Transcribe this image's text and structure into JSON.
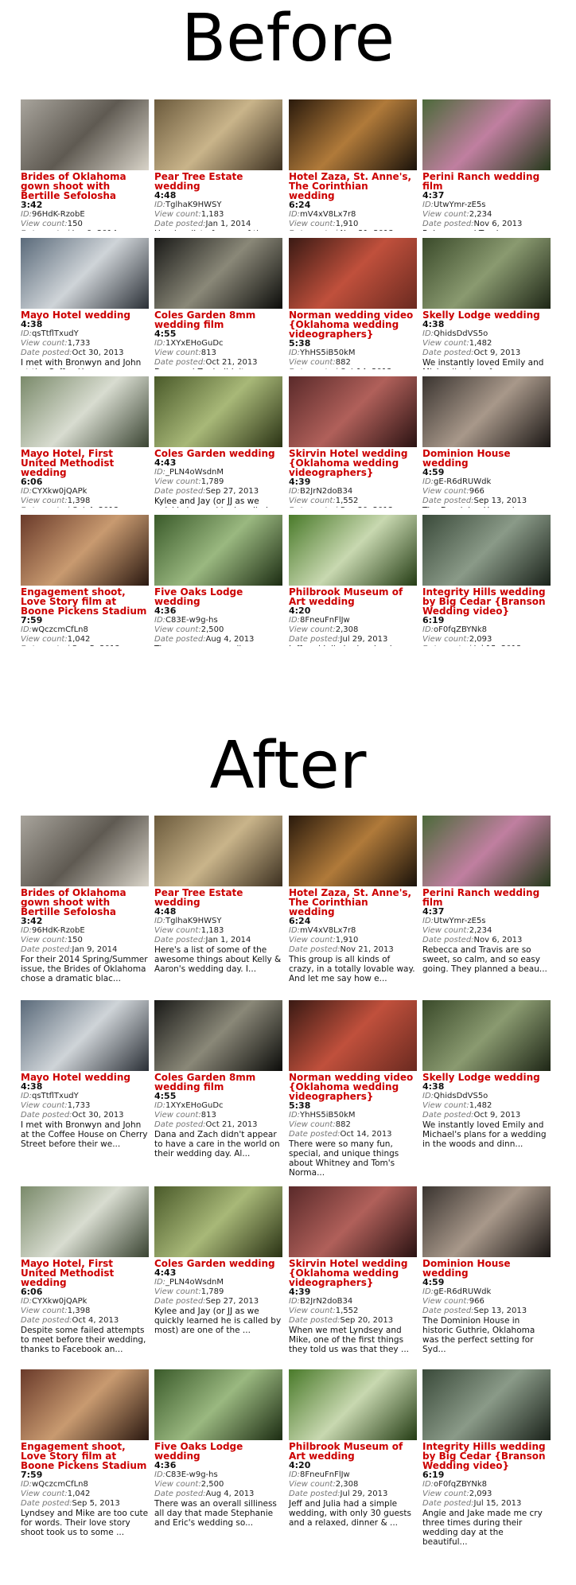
{
  "headings": {
    "before": "Before",
    "after": "After"
  },
  "labels": {
    "id": "ID:",
    "views": "View count:",
    "date": "Date posted:"
  },
  "videos": [
    {
      "title": "Brides of Oklahoma gown shoot with Bertille Sefolosha",
      "duration": "3:42",
      "id": "96HdK-RzobE",
      "views": "150",
      "date": "Jan 9, 2014",
      "desc_before": "",
      "desc_after": "For their 2014 Spring/Summer issue, the Brides of Oklahoma chose a dramatic blac...",
      "colors": [
        "#a8a49c",
        "#5f5a52",
        "#d8d3c8"
      ]
    },
    {
      "title": "Pear Tree Estate wedding",
      "duration": "4:48",
      "id": "TglhaK9HWSY",
      "views": "1,183",
      "date": "Jan 1, 2014",
      "desc_before": "Here's a list of some of the",
      "desc_after": "Here's a list of some of the awesome things about Kelly & Aaron's wedding day. I...",
      "colors": [
        "#6b5a3c",
        "#c9b48a",
        "#3c3020"
      ]
    },
    {
      "title": "Hotel Zaza, St. Anne's, The Corinthian wedding",
      "duration": "6:24",
      "id": "mV4xV8Lx7r8",
      "views": "1,910",
      "date": "Nov 21, 2013",
      "desc_before": "",
      "desc_after": "This group is all kinds of crazy, in a totally lovable way. And let me say how e...",
      "colors": [
        "#2a1a0c",
        "#b07a3a",
        "#1a120a"
      ]
    },
    {
      "title": "Perini Ranch wedding film",
      "duration": "4:37",
      "id": "UtwYmr-zE5s",
      "views": "2,234",
      "date": "Nov 6, 2013",
      "desc_before": "Rebecca and Travis are so",
      "desc_after": "Rebecca and Travis are so sweet, so calm, and so easy going. They planned a beau...",
      "colors": [
        "#4c6a3a",
        "#c07fa0",
        "#263a1c"
      ]
    },
    {
      "title": "Mayo Hotel wedding",
      "duration": "4:38",
      "id": "qsTtflTxudY",
      "views": "1,733",
      "date": "Oct 30, 2013",
      "desc_before": "I met with Bronwyn and John at the Coffee House on",
      "desc_after": "I met with Bronwyn and John at the Coffee House on Cherry Street before their we...",
      "colors": [
        "#5a6a7a",
        "#cfd4d8",
        "#2a2f36"
      ]
    },
    {
      "title": "Coles Garden 8mm wedding film",
      "duration": "4:55",
      "id": "1XYxEHoGuDc",
      "views": "813",
      "date": "Oct 21, 2013",
      "desc_before": "Dana and Zach didn't",
      "desc_after": "Dana and Zach didn't appear to have a care in the world on their wedding day. Al...",
      "colors": [
        "#1a1a18",
        "#8a8878",
        "#0c0c0a"
      ]
    },
    {
      "title": "Norman wedding video {Oklahoma wedding videographers}",
      "duration": "5:38",
      "id": "YhHS5iB50kM",
      "views": "882",
      "date": "Oct 14, 2013",
      "desc_before": "",
      "desc_after": "There were so many fun, special, and unique things about Whitney and Tom's Norma...",
      "colors": [
        "#3a1a14",
        "#c0503c",
        "#6a2a20"
      ]
    },
    {
      "title": "Skelly Lodge wedding",
      "duration": "4:38",
      "id": "QhidsDdVS5o",
      "views": "1,482",
      "date": "Oct 9, 2013",
      "desc_before": "We instantly loved Emily and Michael's plans for a",
      "desc_after": "We instantly loved Emily and Michael's plans for a wedding in the woods and dinn...",
      "colors": [
        "#3a4a2a",
        "#8a9a70",
        "#1e2616"
      ]
    },
    {
      "title": "Mayo Hotel, First United Methodist wedding",
      "duration": "6:06",
      "id": "CYXkw0jQAPk",
      "views": "1,398",
      "date": "Oct 4, 2013",
      "desc_before": "",
      "desc_after": "Despite some failed attempts to meet before their wedding, thanks to Facebook an...",
      "colors": [
        "#7a8a6a",
        "#d8dcd0",
        "#3a4432"
      ]
    },
    {
      "title": "Coles Garden wedding",
      "duration": "4:43",
      "id": "_PLN4oWsdnM",
      "views": "1,789",
      "date": "Sep 27, 2013",
      "desc_before": "Kylee and Jay (or JJ as we quickly learned he is called",
      "desc_after": "Kylee and Jay (or JJ as we quickly learned he is called by most) are one of the ...",
      "colors": [
        "#4a5a2a",
        "#a8b878",
        "#2a3214"
      ]
    },
    {
      "title": "Skirvin Hotel wedding {Oklahoma wedding videographers}",
      "duration": "4:39",
      "id": "B2JrN2doB34",
      "views": "1,552",
      "date": "Sep 20, 2013",
      "desc_before": "",
      "desc_after": "When we met Lyndsey and Mike, one of the first things they told us was that they ...",
      "colors": [
        "#5a2a2a",
        "#b0605a",
        "#2a1212"
      ]
    },
    {
      "title": "Dominion House wedding",
      "duration": "4:59",
      "id": "gE-R6dRUWdk",
      "views": "966",
      "date": "Sep 13, 2013",
      "desc_before": "The Dominion House in",
      "desc_after": "The Dominion House in historic Guthrie, Oklahoma was the perfect setting for Syd...",
      "colors": [
        "#3a3430",
        "#a8988a",
        "#1a1614"
      ]
    },
    {
      "title": "Engagement shoot, Love Story film at Boone Pickens Stadium",
      "duration": "7:59",
      "id": "wQczcmCfLn8",
      "views": "1,042",
      "date": "Sep 5, 2013",
      "desc_before": "",
      "desc_after": "Lyndsey and Mike are too cute for words. Their love story shoot took us to some ...",
      "colors": [
        "#6a3a2a",
        "#c89a70",
        "#2a1810"
      ]
    },
    {
      "title": "Five Oaks Lodge wedding",
      "duration": "4:36",
      "id": "C83E-w9g-hs",
      "views": "2,500",
      "date": "Aug 4, 2013",
      "desc_before": "There was an overall",
      "desc_after": "There was an overall silliness all day that made Stephanie and Eric's wedding so...",
      "colors": [
        "#3a5a2a",
        "#9ab880",
        "#1c2c12"
      ]
    },
    {
      "title": "Philbrook Museum of Art wedding",
      "duration": "4:20",
      "id": "8FneuFnFlJw",
      "views": "2,308",
      "date": "Jul 29, 2013",
      "desc_before": "Jeff and Julia had a simple",
      "desc_after": "Jeff and Julia had a simple wedding, with only 30 guests and a relaxed, dinner & ...",
      "colors": [
        "#4a7a2a",
        "#c8d8b0",
        "#243c14"
      ]
    },
    {
      "title": "Integrity Hills wedding by Big Cedar {Branson Wedding video}",
      "duration": "6:19",
      "id": "oF0fqZBYNk8",
      "views": "2,093",
      "date": "Jul 15, 2013",
      "desc_before": "",
      "desc_after": "Angie and Jake made me cry three times during their wedding day at the beautiful...",
      "colors": [
        "#3a4a3a",
        "#8a9a88",
        "#1a221a"
      ]
    }
  ]
}
